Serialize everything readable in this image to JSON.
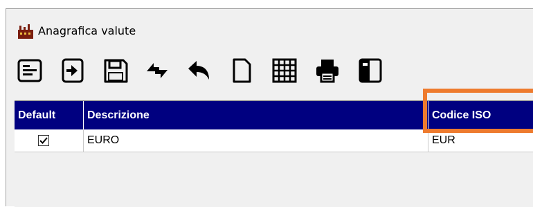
{
  "window": {
    "title": "Anagrafica valute"
  },
  "toolbar": {
    "buttons": [
      {
        "icon": "list-form-icon"
      },
      {
        "icon": "enter-icon"
      },
      {
        "icon": "save-icon"
      },
      {
        "icon": "refresh-icon"
      },
      {
        "icon": "undo-icon"
      },
      {
        "icon": "new-document-icon"
      },
      {
        "icon": "grid-icon"
      },
      {
        "icon": "print-icon"
      },
      {
        "icon": "panel-icon"
      }
    ]
  },
  "grid": {
    "columns": [
      "Default",
      "Descrizione",
      "Codice ISO"
    ],
    "rows": [
      {
        "default": true,
        "descrizione": "EURO",
        "codice_iso": "EUR"
      }
    ]
  },
  "colors": {
    "header_bg": "#000080",
    "highlight": "#ee7b2e"
  }
}
